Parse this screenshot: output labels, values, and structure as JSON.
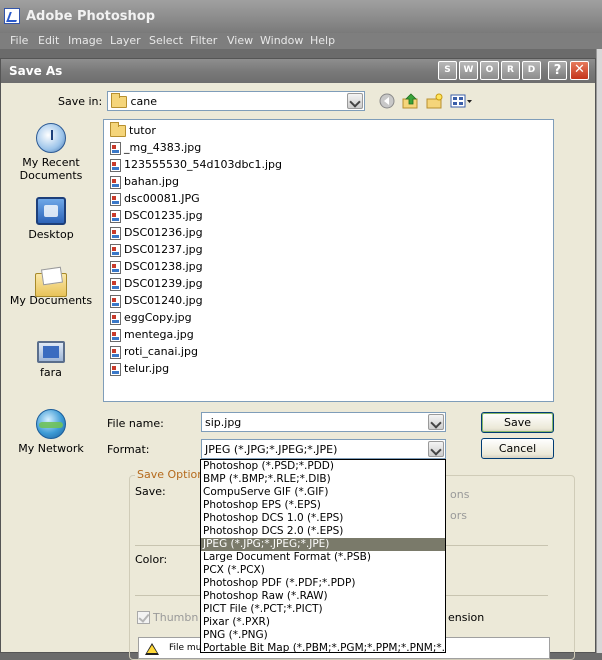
{
  "app": {
    "title": "Adobe Photoshop",
    "menu": [
      "File",
      "Edit",
      "Image",
      "Layer",
      "Select",
      "Filter",
      "View",
      "Window",
      "Help"
    ]
  },
  "dialog": {
    "title": "Save As",
    "title_buttons": [
      "S",
      "W",
      "O",
      "R",
      "D",
      "?",
      "✕"
    ],
    "save_in_label": "Save in:",
    "save_in_value": "cane",
    "toolbar_icons": [
      "back-icon",
      "up-folder-icon",
      "new-folder-icon",
      "views-menu-icon"
    ],
    "places": [
      {
        "label": "My Recent Documents",
        "icon": "recent-documents-icon"
      },
      {
        "label": "Desktop",
        "icon": "desktop-icon"
      },
      {
        "label": "My Documents",
        "icon": "my-documents-icon"
      },
      {
        "label": "fara",
        "icon": "my-computer-icon"
      },
      {
        "label": "My Network",
        "icon": "network-icon"
      }
    ],
    "files": [
      {
        "name": "tutor",
        "type": "folder"
      },
      {
        "name": "_mg_4383.jpg",
        "type": "image"
      },
      {
        "name": "123555530_54d103dbc1.jpg",
        "type": "image"
      },
      {
        "name": "bahan.jpg",
        "type": "image"
      },
      {
        "name": "dsc00081.JPG",
        "type": "image"
      },
      {
        "name": "DSC01235.jpg",
        "type": "image"
      },
      {
        "name": "DSC01236.jpg",
        "type": "image"
      },
      {
        "name": "DSC01237.jpg",
        "type": "image"
      },
      {
        "name": "DSC01238.jpg",
        "type": "image"
      },
      {
        "name": "DSC01239.jpg",
        "type": "image"
      },
      {
        "name": "DSC01240.jpg",
        "type": "image"
      },
      {
        "name": "eggCopy.jpg",
        "type": "image"
      },
      {
        "name": "mentega.jpg",
        "type": "image"
      },
      {
        "name": "roti_canai.jpg",
        "type": "image"
      },
      {
        "name": "telur.jpg",
        "type": "image"
      }
    ],
    "file_name_label": "File name:",
    "file_name_value": "sip.jpg",
    "format_label": "Format:",
    "format_value": "JPEG (*.JPG;*.JPEG;*.JPE)",
    "save_button": "Save",
    "cancel_button": "Cancel",
    "save_options": {
      "group_label": "Save Option",
      "save_label": "Save:",
      "color_label": "Color:",
      "thumbnail_label": "Thumbn",
      "right_fragment_1": "ons",
      "right_fragment_2": "ors",
      "right_fragment_3": "ension",
      "warning_text": "File mu"
    },
    "format_options": [
      "Photoshop (*.PSD;*.PDD)",
      "BMP (*.BMP;*.RLE;*.DIB)",
      "CompuServe GIF (*.GIF)",
      "Photoshop EPS (*.EPS)",
      "Photoshop DCS 1.0 (*.EPS)",
      "Photoshop DCS 2.0 (*.EPS)",
      "JPEG (*.JPG;*.JPEG;*.JPE)",
      "Large Document Format (*.PSB)",
      "PCX (*.PCX)",
      "Photoshop PDF (*.PDF;*.PDP)",
      "Photoshop Raw (*.RAW)",
      "PICT File (*.PCT;*.PICT)",
      "Pixar (*.PXR)",
      "PNG (*.PNG)",
      "Portable Bit Map (*.PBM;*.PGM;*.PPM;*.PNM;*.PFM"
    ],
    "selected_format_index": 6
  }
}
